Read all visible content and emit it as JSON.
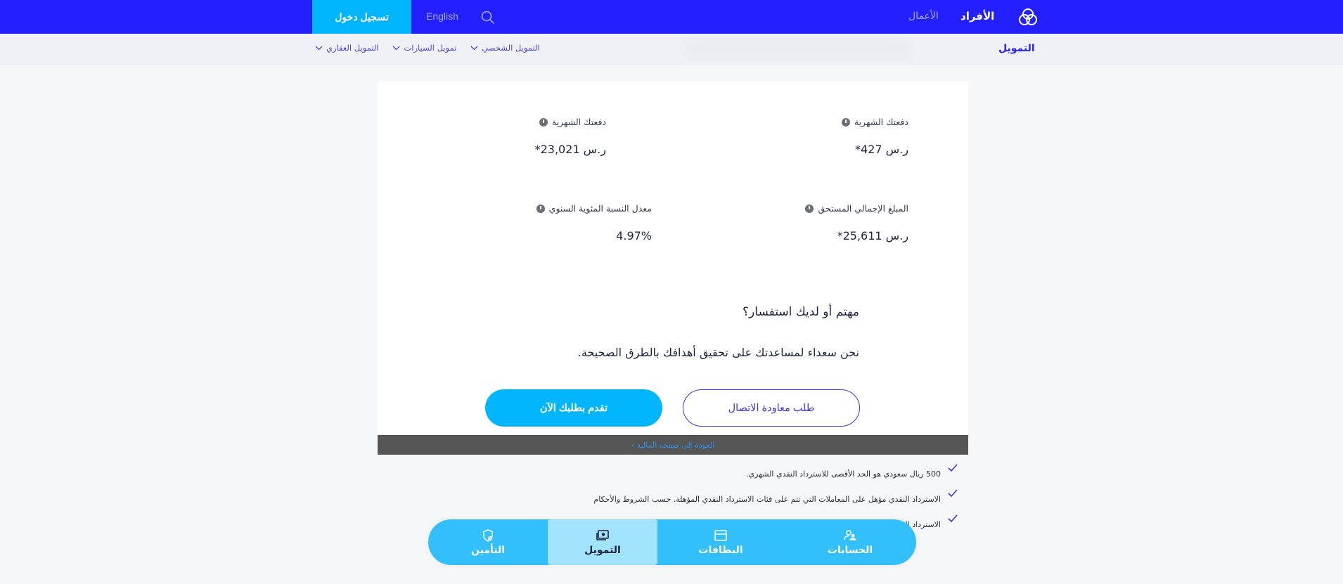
{
  "header": {
    "login_label": "تسجيل دخول",
    "language_label": "English",
    "nav_personal": "الأفراد",
    "nav_business": "الأعمال",
    "colors": {
      "brand": "#231ffe",
      "accent": "#00b5fb"
    }
  },
  "subnav": {
    "title": "التمويل",
    "links": [
      {
        "label": "التمويل العقاري"
      },
      {
        "label": "تمويل السيارات"
      },
      {
        "label": "التمويل الشخصي"
      }
    ]
  },
  "results": {
    "monthly_payment_1": {
      "label": "دفعتك الشهرية",
      "value": "ر.س 427*"
    },
    "monthly_payment_2": {
      "label": "دفعتك الشهرية",
      "value": "ر.س 23,021*"
    },
    "total_amount_due": {
      "label": "المبلغ الإجمالي المستحق",
      "value": "ر.س 25,611*"
    },
    "apr": {
      "label": "معدل النسبة المئوية السنوي",
      "value": "4.97%"
    }
  },
  "inquiry": {
    "title": "مهتم أو لديك استفسار؟",
    "text": "نحن سعداء لمساعدتك على تحقيق أهدافك بالطرق الصحيحة.",
    "callback_label": "طلب معاودة الاتصال",
    "apply_label": "تقدم بطلبك الآن"
  },
  "back_link": "العودة إلى صفحة المالية ›",
  "bullets": [
    "500 ريال سعودي هو الحد الأقصى للاسترداد النقدي الشهري.",
    "الاسترداد النقدي مؤهل على المعاملات التي تتم على فئات الاسترداد النقدي المؤهلة. حسب الشروط والأحكام",
    "الاسترداد ال"
  ],
  "bottom_nav": {
    "items": [
      {
        "label": "التأمين",
        "icon": "shield-icon"
      },
      {
        "label": "التمويل",
        "icon": "money-icon",
        "active": true
      },
      {
        "label": "البطاقات",
        "icon": "card-icon"
      },
      {
        "label": "الحسابات",
        "icon": "accounts-icon"
      }
    ]
  }
}
